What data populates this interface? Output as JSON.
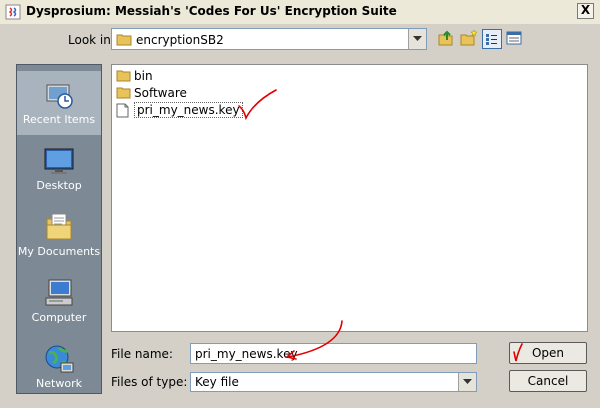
{
  "window": {
    "title": "Dysprosium: Messiah's 'Codes For Us' Encryption Suite",
    "close_symbol": "X"
  },
  "lookin": {
    "label": "Look in:",
    "value": "encryptionSB2"
  },
  "toolbar": {
    "icons": [
      "up-folder-icon",
      "new-folder-icon",
      "list-view-icon",
      "details-view-icon"
    ]
  },
  "places": [
    {
      "label": "Recent Items",
      "icon": "recent-items-icon",
      "selected": true
    },
    {
      "label": "Desktop",
      "icon": "desktop-icon",
      "selected": false
    },
    {
      "label": "My Documents",
      "icon": "my-documents-icon",
      "selected": false
    },
    {
      "label": "Computer",
      "icon": "computer-icon",
      "selected": false
    },
    {
      "label": "Network",
      "icon": "network-icon",
      "selected": false
    }
  ],
  "files": [
    {
      "name": "bin",
      "type": "folder"
    },
    {
      "name": "Software",
      "type": "folder"
    },
    {
      "name": "pri_my_news.key",
      "type": "file"
    }
  ],
  "filename": {
    "label": "File name:",
    "value": "pri_my_news.key"
  },
  "filetype": {
    "label": "Files of type:",
    "value": "Key file"
  },
  "buttons": {
    "open": "Open",
    "cancel": "Cancel"
  },
  "colors": {
    "annotation": "#e00000",
    "sidebar": "#7d8a96",
    "dialog_bg": "#d4d0c8"
  }
}
